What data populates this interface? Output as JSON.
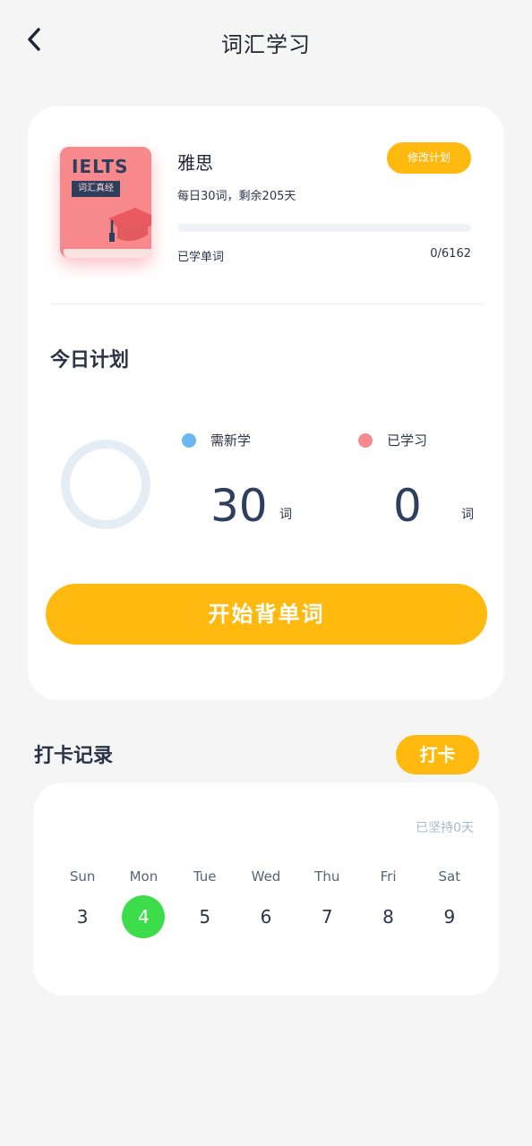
{
  "header": {
    "title": "词汇学习",
    "back_icon": "chevron-left-icon"
  },
  "book": {
    "cover_title": "IELTS",
    "cover_subtitle": "词汇真经",
    "cover_color": "#f6878a",
    "name": "雅思",
    "edit_plan_label": "修改计划",
    "plan_desc": "每日30词，剩余205天",
    "progress_fraction": 0,
    "learned_label": "已学单词",
    "learned_count": "0/6162"
  },
  "today": {
    "title": "今日计划",
    "new_label": "需新学",
    "new_color": "#6cb7f0",
    "new_count": "30",
    "done_label": "已学习",
    "done_color": "#f3898c",
    "done_count": "0",
    "unit": "词",
    "start_label": "开始背单词"
  },
  "checkin": {
    "title": "打卡记录",
    "button_label": "打卡",
    "streak": "已坚持0天",
    "weekdays": [
      "Sun",
      "Mon",
      "Tue",
      "Wed",
      "Thu",
      "Fri",
      "Sat"
    ],
    "dates": [
      "3",
      "4",
      "5",
      "6",
      "7",
      "8",
      "9"
    ],
    "today_index": 1
  },
  "colors": {
    "accent": "#ffb90f",
    "today_green": "#3ddc4b",
    "background": "#f5f5f5"
  }
}
